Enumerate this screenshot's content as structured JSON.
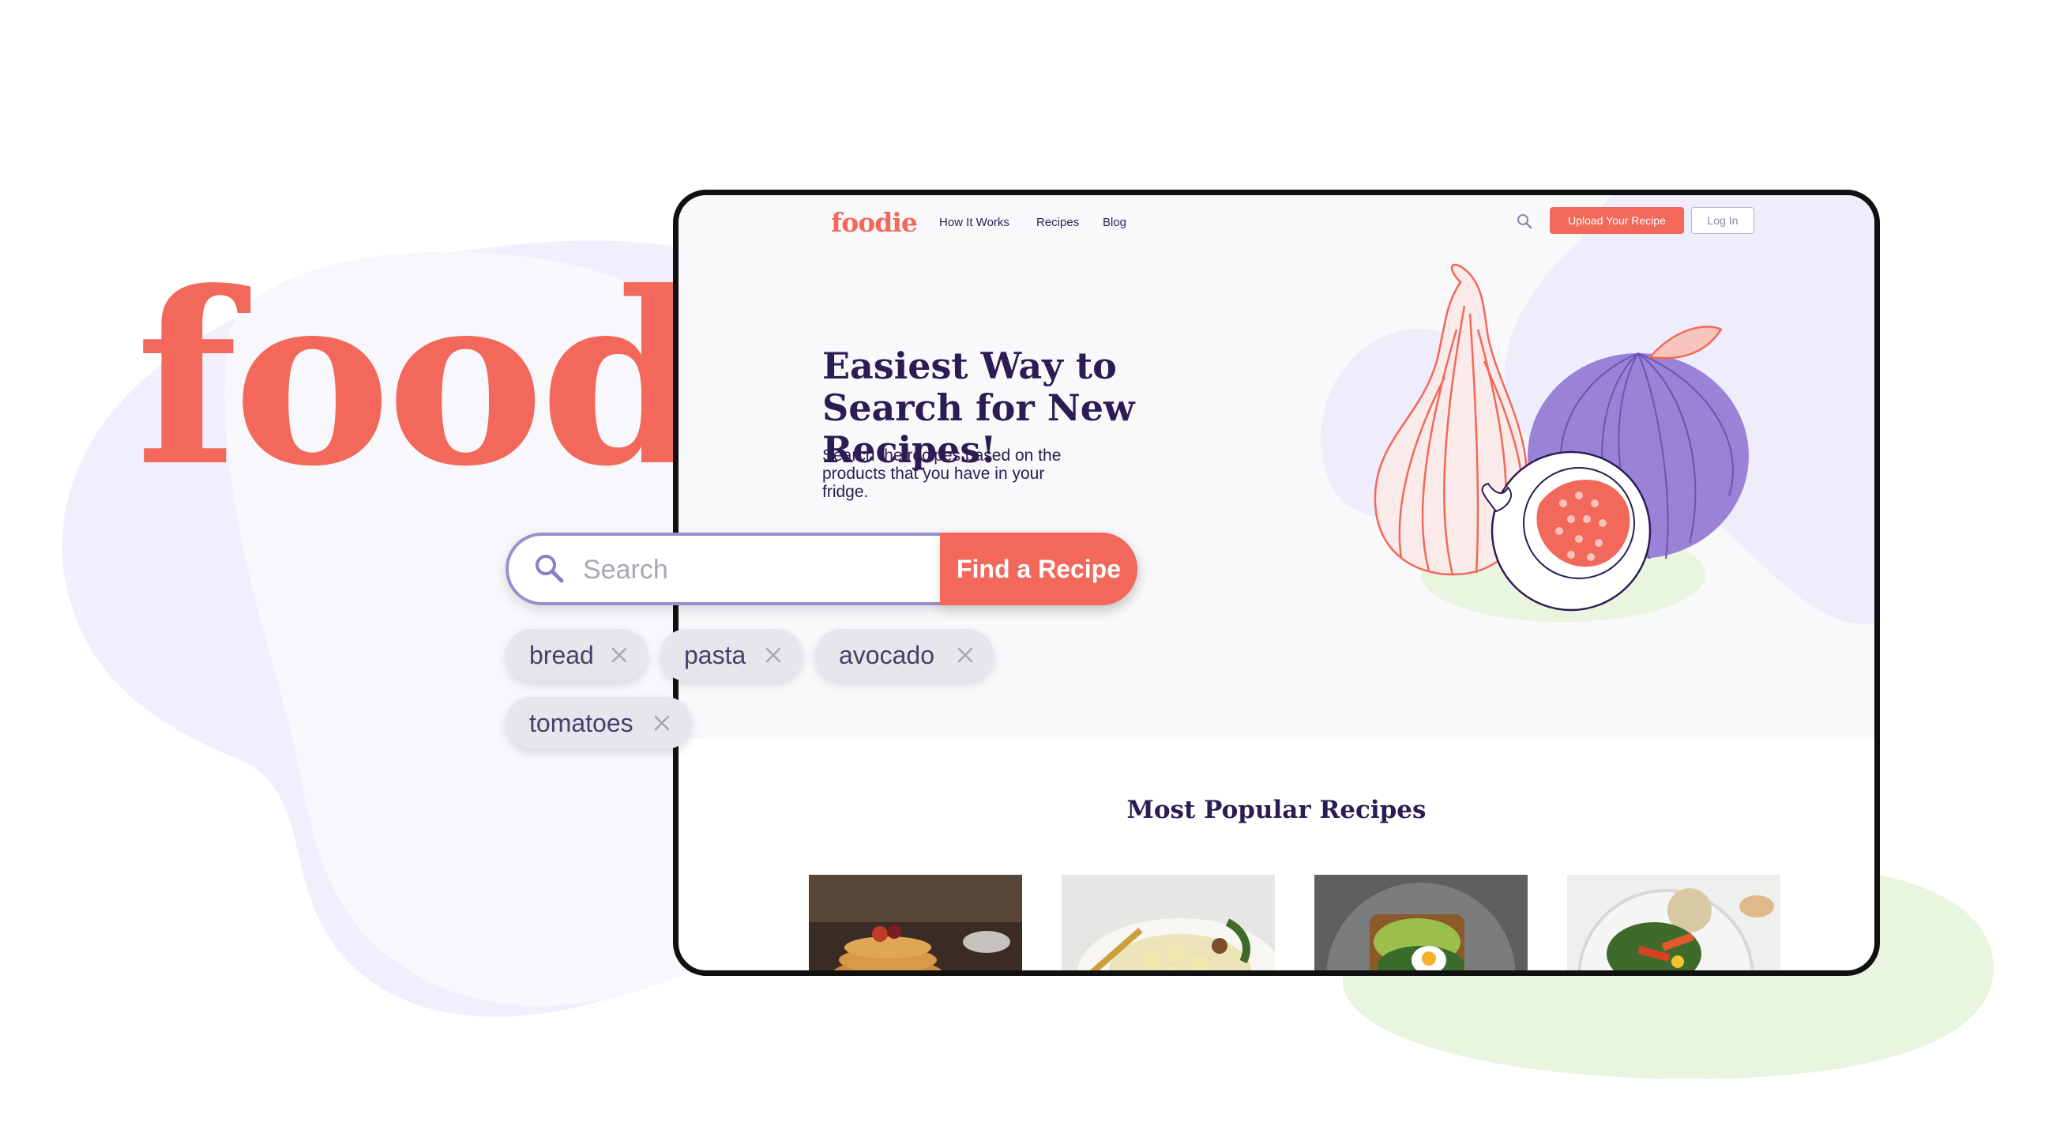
{
  "brand": {
    "wordmark": "foodie",
    "color": "#f2685a"
  },
  "site": {
    "logo": "foodie",
    "nav": [
      {
        "label": "How It Works"
      },
      {
        "label": "Recipes"
      },
      {
        "label": "Blog"
      }
    ],
    "upload_label": "Upload Your Recipe",
    "login_label": "Log In",
    "hero": {
      "title": "Easiest Way to Search for New Recipes!",
      "subtitle": "Search the recipes based on the products that you have in your fridge."
    },
    "popular_title": "Most Popular Recipes",
    "recipe_cards": [
      {
        "image": "pancakes-photo"
      },
      {
        "image": "gnocchi-photo"
      },
      {
        "image": "avocado-toast-photo"
      },
      {
        "image": "veggie-bowl-photo"
      }
    ]
  },
  "search": {
    "placeholder": "Search",
    "value": "",
    "button_label": "Find a Recipe"
  },
  "filters": [
    {
      "label": "bread"
    },
    {
      "label": "pasta"
    },
    {
      "label": "avocado"
    },
    {
      "label": "tomatoes"
    }
  ],
  "colors": {
    "accent": "#f2685a",
    "navy": "#2b1d54",
    "lavender": "#efecfc",
    "mint": "#e9f5df",
    "chip": "#e7e6ec"
  }
}
